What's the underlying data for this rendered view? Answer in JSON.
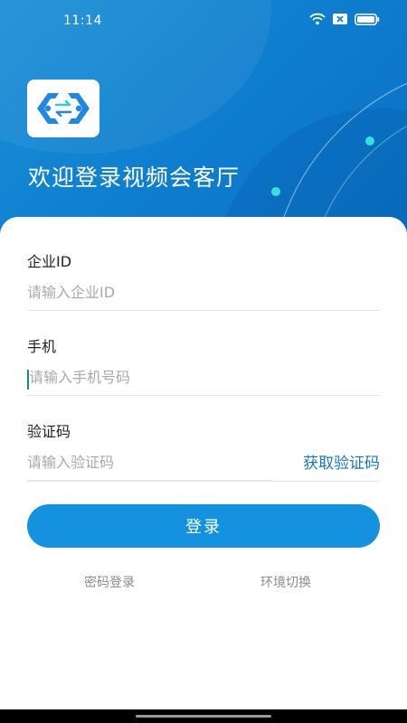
{
  "status_bar": {
    "time": "11:14"
  },
  "header": {
    "welcome_text": "欢迎登录视频会客厅"
  },
  "form": {
    "company_id": {
      "label": "企业ID",
      "placeholder": "请输入企业ID",
      "value": ""
    },
    "phone": {
      "label": "手机",
      "placeholder": "请输入手机号码",
      "value": ""
    },
    "code": {
      "label": "验证码",
      "placeholder": "请输入验证码",
      "value": "",
      "get_code_label": "获取验证码"
    },
    "login_label": "登录"
  },
  "links": {
    "password_login": "密码登录",
    "switch_env": "环境切换"
  },
  "colors": {
    "primary": "#1592df",
    "accent_link": "#1478c0",
    "header_bg": "#0f7fd0",
    "logo_blue": "#1e88e5"
  }
}
